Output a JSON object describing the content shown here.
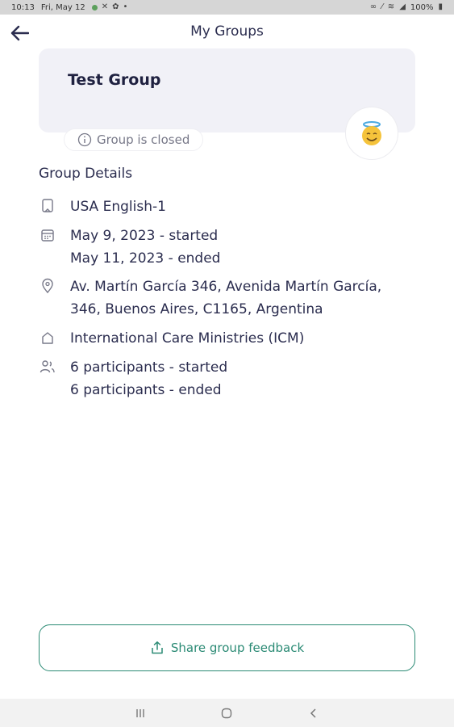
{
  "status_bar": {
    "time": "10:13",
    "date": "Fri, May 12",
    "battery": "100%"
  },
  "header": {
    "title": "My Groups"
  },
  "group": {
    "name": "Test Group",
    "status": "Group is closed"
  },
  "details": {
    "section_title": "Group Details",
    "language": "USA English-1",
    "date_started": "May 9, 2023 - started",
    "date_ended": "May 11, 2023 - ended",
    "address_line1": "Av. Martín García 346, Avenida Martín García,",
    "address_line2": "346, Buenos Aires, C1165, Argentina",
    "organization": "International Care Ministries (ICM)",
    "participants_started": "6 participants - started",
    "participants_ended": "6 participants - ended"
  },
  "feedback": {
    "label": "Share group feedback"
  },
  "colors": {
    "accent": "#2a8a74",
    "text": "#2b2d4f",
    "card_bg": "#f1f1f7"
  }
}
